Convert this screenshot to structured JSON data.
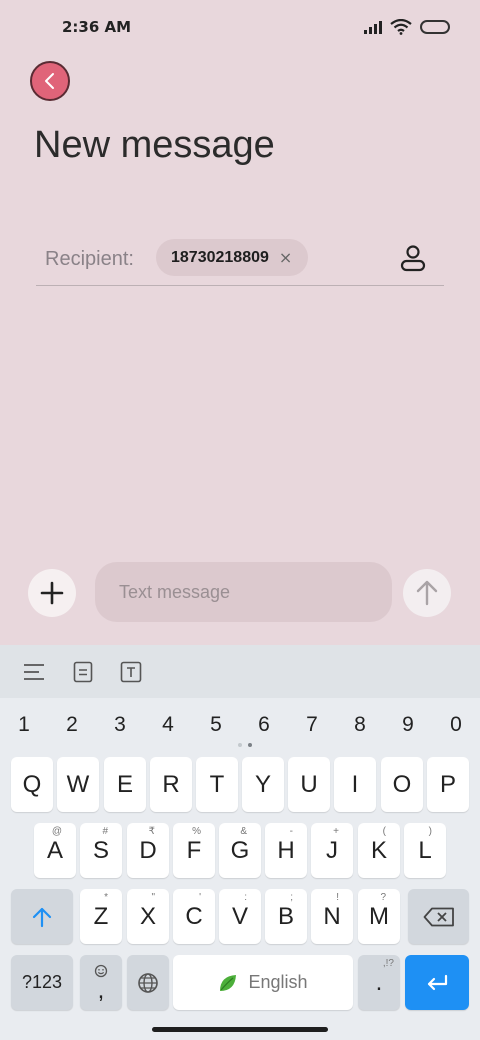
{
  "status": {
    "time": "2:36 AM"
  },
  "header": {
    "title": "New message"
  },
  "recipient": {
    "label": "Recipient:",
    "chip_value": "18730218809",
    "chip_close": "×"
  },
  "compose": {
    "placeholder": "Text message"
  },
  "keyboard": {
    "numbers": [
      "1",
      "2",
      "3",
      "4",
      "5",
      "6",
      "7",
      "8",
      "9",
      "0"
    ],
    "row1": [
      {
        "label": "Q"
      },
      {
        "label": "W"
      },
      {
        "label": "E"
      },
      {
        "label": "R"
      },
      {
        "label": "T"
      },
      {
        "label": "Y"
      },
      {
        "label": "U"
      },
      {
        "label": "I"
      },
      {
        "label": "O"
      },
      {
        "label": "P"
      }
    ],
    "row2": [
      {
        "label": "A",
        "hint": "@"
      },
      {
        "label": "S",
        "hint": "#"
      },
      {
        "label": "D",
        "hint": "₹"
      },
      {
        "label": "F",
        "hint": "%"
      },
      {
        "label": "G",
        "hint": "&"
      },
      {
        "label": "H",
        "hint": "-"
      },
      {
        "label": "J",
        "hint": "+"
      },
      {
        "label": "K",
        "hint": "("
      },
      {
        "label": "L",
        "hint": ")"
      }
    ],
    "row3": [
      {
        "label": "Z",
        "hint": "*"
      },
      {
        "label": "X",
        "hint": "\""
      },
      {
        "label": "C",
        "hint": "'"
      },
      {
        "label": "V",
        "hint": ":"
      },
      {
        "label": "B",
        "hint": ";"
      },
      {
        "label": "N",
        "hint": "!"
      },
      {
        "label": "M",
        "hint": "?"
      }
    ],
    "symbols_label": "?123",
    "comma_label": ",",
    "space_label": "English",
    "period_label": ".",
    "period_hint": ",!?"
  },
  "colors": {
    "background": "#e8d7dc",
    "accent_back": "#e06479",
    "enter_key": "#1e90f4"
  }
}
